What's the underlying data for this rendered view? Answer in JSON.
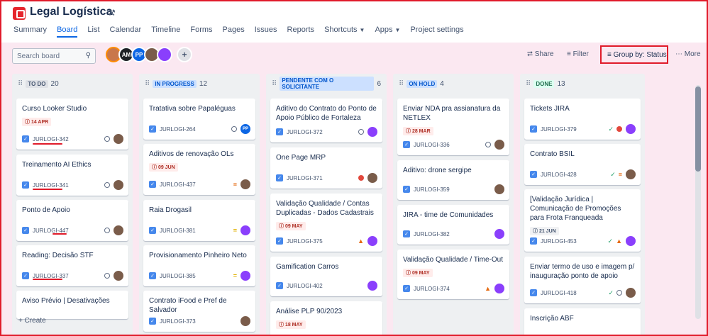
{
  "project": {
    "title": "Legal Logística"
  },
  "tabs": [
    "Summary",
    "Board",
    "List",
    "Calendar",
    "Timeline",
    "Forms",
    "Pages",
    "Issues",
    "Reports",
    "Shortcuts",
    "Apps",
    "Project settings"
  ],
  "toolbar": {
    "search_placeholder": "Search board",
    "share": "Share",
    "filter": "Filter",
    "group_by": "Group by: Status",
    "more": "More"
  },
  "avatars": [
    "",
    "AM",
    "PP",
    "",
    ""
  ],
  "colors": {
    "accent": "#0c66e4",
    "frame": "#e01b2a",
    "todo": "#dfe1e6",
    "progress": "#cce0ff",
    "pending": "#cce0ff",
    "hold": "#cce0ff",
    "done": "#dcfff1"
  },
  "columns": [
    {
      "name": "TO DO",
      "count": "20",
      "cards": [
        {
          "title": "Curso Looker Studio",
          "due": "14 APR",
          "key": "JURLOGI-342"
        },
        {
          "title": "Treinamento AI Ethics",
          "key": "JURLOGI-341"
        },
        {
          "title": "Ponto de Apoio",
          "key": "JURLOGI-447"
        },
        {
          "title": "Reading: Decisão STF",
          "key": "JURLOGI-337"
        },
        {
          "title": "Aviso Prévio | Desativações"
        }
      ],
      "create": "+ Create"
    },
    {
      "name": "IN PROGRESS",
      "count": "12",
      "cards": [
        {
          "title": "Tratativa sobre Papaléguas",
          "key": "JURLOGI-264",
          "assignee": "PP"
        },
        {
          "title": "Aditivos de renovação OLs",
          "due": "09 JUN",
          "key": "JURLOGI-437"
        },
        {
          "title": "Raia Drogasil",
          "key": "JURLOGI-381"
        },
        {
          "title": "Provisionamento Pinheiro Neto",
          "key": "JURLOGI-385"
        },
        {
          "title": "Contrato iFood e Pref de Salvador",
          "key": "JURLOGI-373"
        }
      ]
    },
    {
      "name": "PENDENTE COM O SOLICITANTE",
      "count": "6",
      "cards": [
        {
          "title": "Aditivo do Contrato do Ponto de Apoio Público de Fortaleza",
          "key": "JURLOGI-372"
        },
        {
          "title": "One Page MRP",
          "key": "JURLOGI-371"
        },
        {
          "title": "Validação Qualidade / Contas Duplicadas - Dados Cadastrais",
          "due": "09 MAY",
          "key": "JURLOGI-375"
        },
        {
          "title": "Gamification Carros",
          "key": "JURLOGI-402"
        },
        {
          "title": "Análise PLP 90/2023",
          "due": "18 MAY"
        }
      ]
    },
    {
      "name": "ON HOLD",
      "count": "4",
      "cards": [
        {
          "title": "Enviar NDA pra assianatura da NETLEX",
          "due": "28 MAR",
          "key": "JURLOGI-336"
        },
        {
          "title": "Aditivo: drone sergipe",
          "key": "JURLOGI-359"
        },
        {
          "title": "JIRA - time de Comunidades",
          "key": "JURLOGI-382"
        },
        {
          "title": "Validação Qualidade / Time-Out",
          "due": "09 MAY",
          "key": "JURLOGI-374"
        }
      ]
    },
    {
      "name": "DONE",
      "count": "13",
      "cards": [
        {
          "title": "Tickets JIRA",
          "key": "JURLOGI-379"
        },
        {
          "title": "Contrato BSIL",
          "key": "JURLOGI-428"
        },
        {
          "title": "[Validação Jurídica | Comunicação de Promoções para Frota Franqueada",
          "due": "21 JUN",
          "key": "JURLOGI-453"
        },
        {
          "title": "Enviar termo de uso e imagem p/ inauguração ponto de apoio",
          "key": "JURLOGI-418"
        },
        {
          "title": "Inscrição ABF"
        }
      ]
    }
  ]
}
